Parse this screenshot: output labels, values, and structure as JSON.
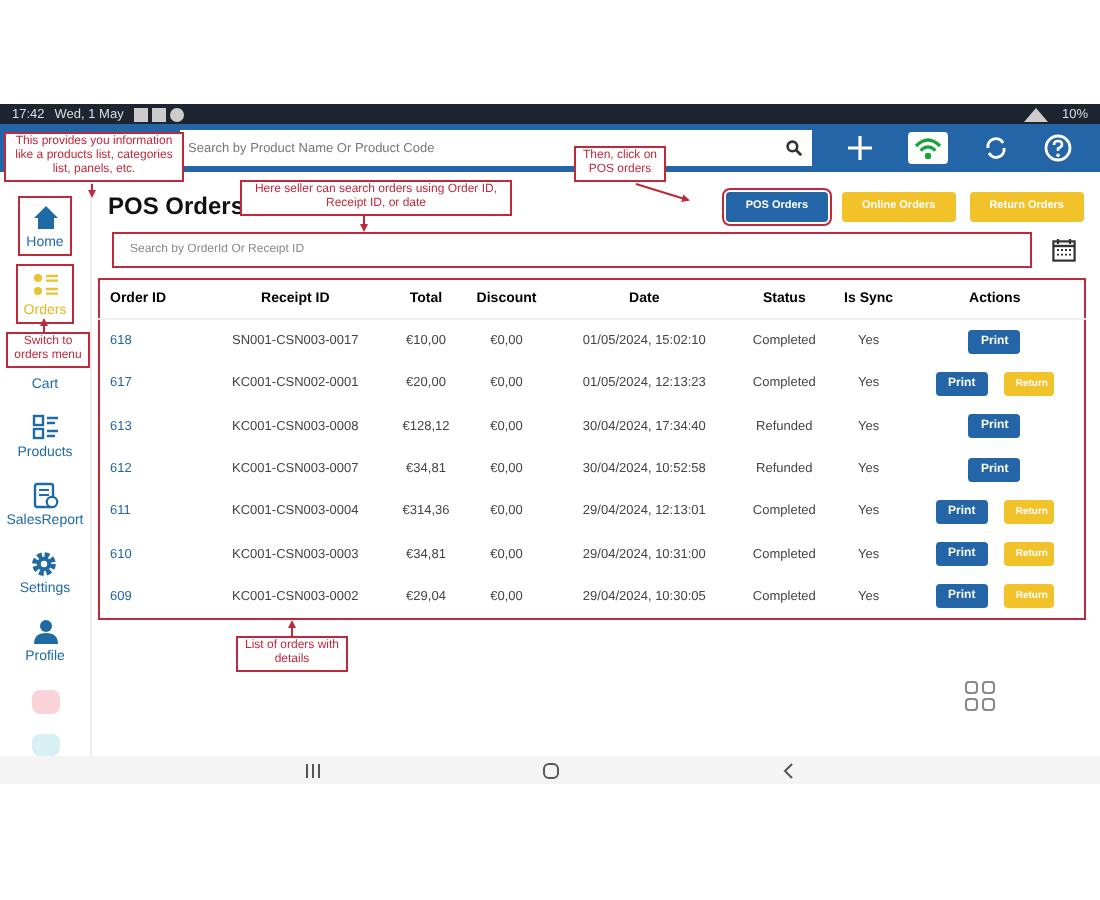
{
  "status_bar": {
    "time": "17:42",
    "date": "Wed, 1 May",
    "battery": "10%"
  },
  "top_bar": {
    "search": {
      "placeholder": "Search by Product Name Or Product Code"
    }
  },
  "sidebar": {
    "items": [
      {
        "label": "Home",
        "selected": false,
        "highlighted": true
      },
      {
        "label": "Orders",
        "selected": true,
        "highlighted": true
      },
      {
        "label": "Cart",
        "selected": false,
        "highlighted": false
      },
      {
        "label": "Products",
        "selected": false,
        "highlighted": false
      },
      {
        "label": "SalesReport",
        "selected": false,
        "highlighted": false
      },
      {
        "label": "Settings",
        "selected": false,
        "highlighted": false
      },
      {
        "label": "Profile",
        "selected": false,
        "highlighted": false
      }
    ]
  },
  "page": {
    "title": "POS Orders",
    "order_tabs": [
      {
        "label": "POS Orders",
        "selected": true,
        "highlighted": true
      },
      {
        "label": "Online Orders",
        "selected": false,
        "highlighted": false
      },
      {
        "label": "Return Orders",
        "selected": false,
        "highlighted": false
      }
    ],
    "search": {
      "placeholder": "Search by OrderId Or Receipt ID",
      "highlighted": true
    }
  },
  "table": {
    "highlighted": true,
    "columns": [
      "Order ID",
      "Receipt ID",
      "Total",
      "Discount",
      "Date",
      "Status",
      "Is Sync",
      "Actions"
    ],
    "rows": [
      {
        "order_id": "618",
        "receipt_id": "SN001-CSN003-0017",
        "total": "€10,00",
        "discount": "€0,00",
        "date": "01/05/2024, 15:02:10",
        "status": "Completed",
        "is_sync": "Yes",
        "actions": [
          {
            "kind": "print",
            "label": "Print"
          }
        ]
      },
      {
        "order_id": "617",
        "receipt_id": "KC001-CSN002-0001",
        "total": "€20,00",
        "discount": "€0,00",
        "date": "01/05/2024, 12:13:23",
        "status": "Completed",
        "is_sync": "Yes",
        "actions": [
          {
            "kind": "print",
            "label": "Print"
          },
          {
            "kind": "return",
            "label": "Return"
          }
        ]
      },
      {
        "order_id": "613",
        "receipt_id": "KC001-CSN003-0008",
        "total": "€128,12",
        "discount": "€0,00",
        "date": "30/04/2024, 17:34:40",
        "status": "Refunded",
        "is_sync": "Yes",
        "actions": [
          {
            "kind": "print",
            "label": "Print"
          }
        ]
      },
      {
        "order_id": "612",
        "receipt_id": "KC001-CSN003-0007",
        "total": "€34,81",
        "discount": "€0,00",
        "date": "30/04/2024, 10:52:58",
        "status": "Refunded",
        "is_sync": "Yes",
        "actions": [
          {
            "kind": "print",
            "label": "Print"
          }
        ]
      },
      {
        "order_id": "611",
        "receipt_id": "KC001-CSN003-0004",
        "total": "€314,36",
        "discount": "€0,00",
        "date": "29/04/2024, 12:13:01",
        "status": "Completed",
        "is_sync": "Yes",
        "actions": [
          {
            "kind": "print",
            "label": "Print"
          },
          {
            "kind": "return",
            "label": "Return"
          }
        ]
      },
      {
        "order_id": "610",
        "receipt_id": "KC001-CSN003-0003",
        "total": "€34,81",
        "discount": "€0,00",
        "date": "29/04/2024, 10:31:00",
        "status": "Completed",
        "is_sync": "Yes",
        "actions": [
          {
            "kind": "print",
            "label": "Print"
          },
          {
            "kind": "return",
            "label": "Return"
          }
        ]
      },
      {
        "order_id": "609",
        "receipt_id": "KC001-CSN003-0002",
        "total": "€29,04",
        "discount": "€0,00",
        "date": "29/04/2024, 10:30:05",
        "status": "Completed",
        "is_sync": "Yes",
        "actions": [
          {
            "kind": "print",
            "label": "Print"
          },
          {
            "kind": "return",
            "label": "Return"
          }
        ]
      }
    ]
  },
  "annotations": [
    "This provides you information like a products list, categories list, panels, etc.",
    "Here seller can search orders using Order ID, Receipt ID, or date",
    "Then, click on POS orders",
    "Switch to orders menu",
    "List of orders with details"
  ]
}
